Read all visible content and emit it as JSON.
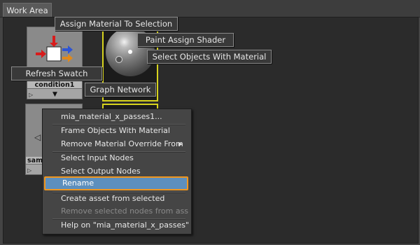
{
  "tab": {
    "label": "Work Area"
  },
  "nodes": {
    "condition": {
      "name": "condition1"
    },
    "sampler": {
      "name": "samp"
    }
  },
  "marking_menu": {
    "assign_material": "Assign Material To Selection",
    "paint_assign": "Paint Assign Shader",
    "select_objects": "Select Objects With Material",
    "refresh_swatch": "Refresh Swatch",
    "graph_network": "Graph Network"
  },
  "context_menu": {
    "header": "mia_material_x_passes1...",
    "items": [
      "Frame Objects With Material",
      "Remove Material Override From",
      "Select Input Nodes",
      "Select Output Nodes",
      "Rename",
      "Create asset from selected",
      "Remove selected nodes from asset",
      "Help on \"mia_material_x_passes\""
    ],
    "highlighted": "Rename",
    "disabled": [
      "Remove selected nodes from asset"
    ]
  },
  "icons": [
    "condition-node-icon",
    "material-sphere-swatch",
    "submenu-arrow-icon",
    "play-icon",
    "triangle-icon"
  ],
  "colors": {
    "highlight": "#5d8fbd",
    "highlight_border": "#f0961e",
    "selection": "#d7d31e"
  }
}
